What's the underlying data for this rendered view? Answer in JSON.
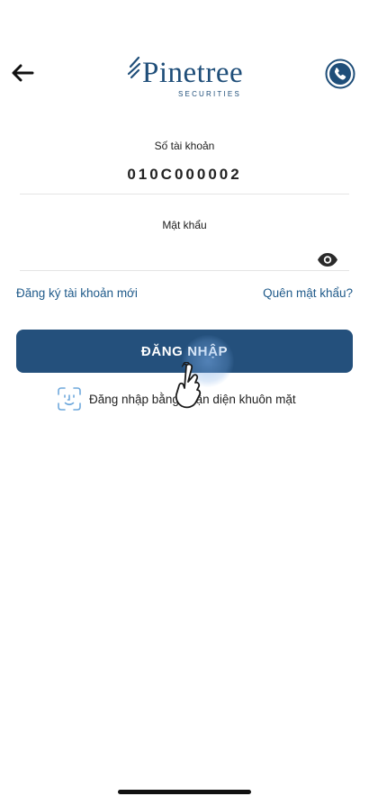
{
  "header": {
    "back_icon": "arrow-left-icon",
    "logo": {
      "brand": "Pinetree",
      "sub": "SECURITIES"
    },
    "phone_icon": "phone-icon"
  },
  "form": {
    "account": {
      "label": "Số tài khoản",
      "value": "010C000002"
    },
    "password": {
      "label": "Mật khẩu",
      "value": "",
      "toggle_icon": "eye-icon"
    },
    "register_link": "Đăng ký tài khoản mới",
    "forgot_link": "Quên mật khẩu?",
    "login_button": "ĐĂNG NHẬP",
    "face_login": {
      "icon": "face-id-icon",
      "label": "Đăng nhập bằng nhận diện khuôn mặt"
    }
  },
  "colors": {
    "primary": "#24507c",
    "brand": "#1f4e79",
    "link": "#1f5a8a"
  }
}
